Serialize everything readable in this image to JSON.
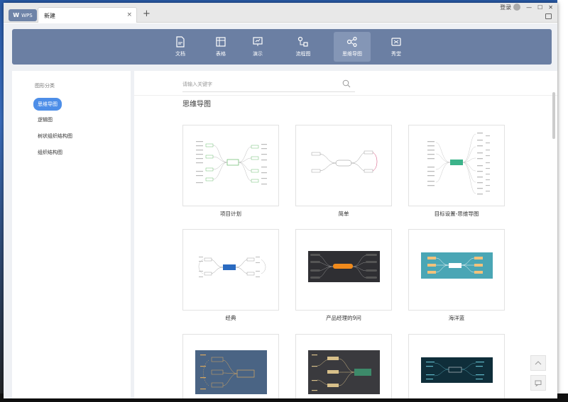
{
  "window": {
    "wps_tab_label": "WPS",
    "doc_tab_label": "新建",
    "login_label": "登录",
    "close_tab": "×",
    "new_tab": "+"
  },
  "nav": {
    "items": [
      {
        "label": "文档",
        "icon": "document-icon"
      },
      {
        "label": "表格",
        "icon": "spreadsheet-icon"
      },
      {
        "label": "演示",
        "icon": "presentation-icon"
      },
      {
        "label": "流程图",
        "icon": "flowchart-icon"
      },
      {
        "label": "思维导图",
        "icon": "mindmap-icon",
        "active": true
      },
      {
        "label": "秀堂",
        "icon": "showcase-icon"
      }
    ]
  },
  "sidebar": {
    "title": "图形分类",
    "items": [
      {
        "label": "思维导图",
        "selected": true
      },
      {
        "label": "逻辑图"
      },
      {
        "label": "树状组织结构图"
      },
      {
        "label": "组织结构图"
      }
    ]
  },
  "search": {
    "placeholder": "请输入关键字"
  },
  "section": {
    "title": "思维导图"
  },
  "templates": [
    {
      "label": "项目计划",
      "style": "light"
    },
    {
      "label": "简单",
      "style": "light"
    },
    {
      "label": "目标设置-思维导图",
      "style": "light"
    },
    {
      "label": "经典",
      "style": "light"
    },
    {
      "label": "产品经理的9问",
      "style": "dark"
    },
    {
      "label": "海洋蓝",
      "style": "teal"
    },
    {
      "label": "",
      "style": "slate"
    },
    {
      "label": "",
      "style": "charcoal"
    },
    {
      "label": "",
      "style": "navy"
    }
  ],
  "colors": {
    "nav_bg": "#6b7fa3",
    "nav_active": "#8496b6",
    "accent": "#4d8ee8",
    "wps_tab": "#6f84a8"
  }
}
